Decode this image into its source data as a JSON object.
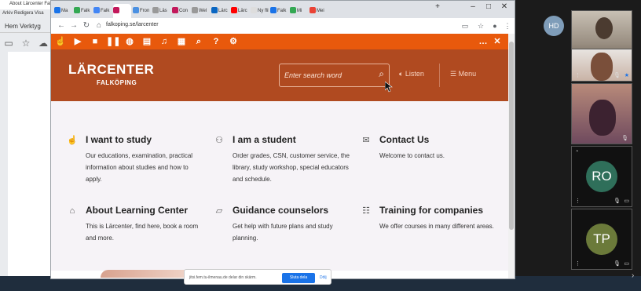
{
  "background_app": {
    "title": "About Lärcenter Falk",
    "menu": "Arkiv  Redigera  Visa",
    "ribbon": "Hem  Verktyg"
  },
  "browser": {
    "tabs": [
      {
        "label": "Ma",
        "color": "#1a73e8"
      },
      {
        "label": "Falk",
        "color": "#34a853"
      },
      {
        "label": "Falk",
        "color": "#4285f4"
      },
      {
        "label": "",
        "color": "#c2185b",
        "active": true
      },
      {
        "label": "Fron",
        "color": "#4a90e2"
      },
      {
        "label": "Läs",
        "color": "#999999"
      },
      {
        "label": "Con",
        "color": "#c2185b"
      },
      {
        "label": "Wel",
        "color": "#999999"
      },
      {
        "label": "Lärc",
        "color": "#0a66c2"
      },
      {
        "label": "Lärc",
        "color": "#ff0000"
      },
      {
        "label": "Ny flik",
        "color": "#dddddd"
      },
      {
        "label": "Falk",
        "color": "#1a73e8"
      },
      {
        "label": "Mi",
        "color": "#34a853"
      },
      {
        "label": "Mei",
        "color": "#ea4335"
      }
    ],
    "url": "falkoping.se/larcenter"
  },
  "site": {
    "logo_line1": "LÄRCENTER",
    "logo_line2": "FALKÖPING",
    "search_placeholder": "Enter search word",
    "listen_label": "Listen",
    "menu_label": "Menu",
    "items": [
      {
        "title": "I want to study",
        "text": "Our educations, examination, practical information about studies and how to apply.",
        "icon": "hand-pointer-icon"
      },
      {
        "title": "I am a student",
        "text": "Order grades, CSN, customer service, the library, study workshop, special educators and schedule.",
        "icon": "students-icon"
      },
      {
        "title": "Contact Us",
        "text": "Welcome to contact us.",
        "icon": "chat-icon"
      },
      {
        "title": "About Learning Center",
        "text": "This is Lärcenter, find here, book a room and more.",
        "icon": "building-icon"
      },
      {
        "title": "Guidance counselors",
        "text": "Get help with future plans and study planning.",
        "icon": "map-icon"
      },
      {
        "title": "Training for companies",
        "text": "We offer courses in many different areas.",
        "icon": "people-icon"
      }
    ]
  },
  "share_bar": {
    "text": "jitsi.fem.tu-ilmenau.de delar din skärm.",
    "stop_label": "Sluta dela",
    "hide_label": "Dölj"
  },
  "meeting": {
    "self_initials": "HD",
    "participants": [
      {
        "initials": "RO",
        "color": "#2f6f5a"
      },
      {
        "initials": "TP",
        "color": "#6b7a3a"
      }
    ]
  }
}
